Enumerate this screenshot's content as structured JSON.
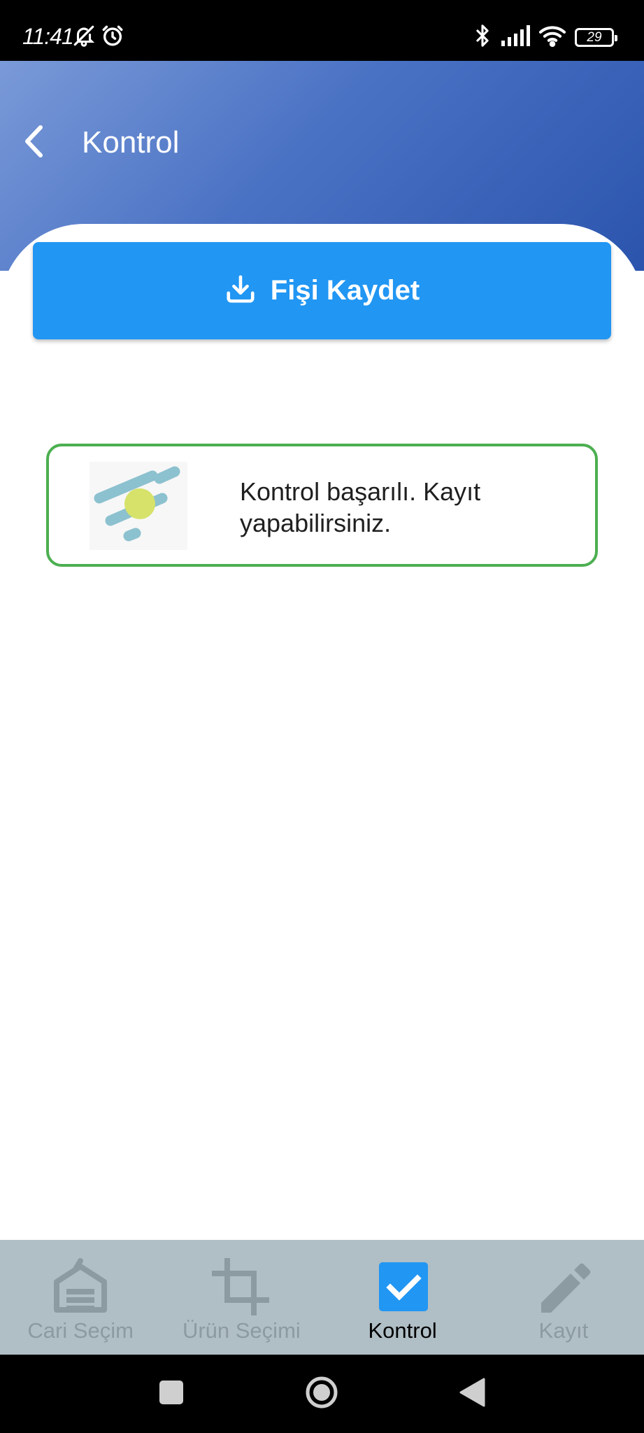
{
  "status_bar": {
    "time": "11:41",
    "battery_level": "29",
    "icons": [
      "bell-off-icon",
      "alarm-icon",
      "bluetooth-icon",
      "signal-icon",
      "wifi-icon",
      "battery-icon"
    ]
  },
  "header": {
    "title": "Kontrol",
    "back_icon": "chevron-left-icon",
    "gradient_colors": [
      "#7a9ad8",
      "#2b54ad"
    ]
  },
  "save_button": {
    "label": "Fişi Kaydet",
    "icon": "download-icon",
    "color": "#2196f3"
  },
  "result": {
    "message": "Kontrol başarılı. Kayıt yapabilirsiniz.",
    "status": "success",
    "border_color": "#4caf50"
  },
  "bottom_nav": {
    "items": [
      {
        "label": "Cari Seçim",
        "icon": "warehouse-icon",
        "active": false
      },
      {
        "label": "Ürün Seçimi",
        "icon": "crop-icon",
        "active": false
      },
      {
        "label": "Kontrol",
        "icon": "checkbox-checked-icon",
        "active": true
      },
      {
        "label": "Kayıt",
        "icon": "pencil-icon",
        "active": false
      }
    ],
    "background": "#b0bec5",
    "active_accent": "#2196f3"
  },
  "system_nav": {
    "buttons": [
      "recents-square-icon",
      "home-circle-icon",
      "back-triangle-icon"
    ]
  }
}
